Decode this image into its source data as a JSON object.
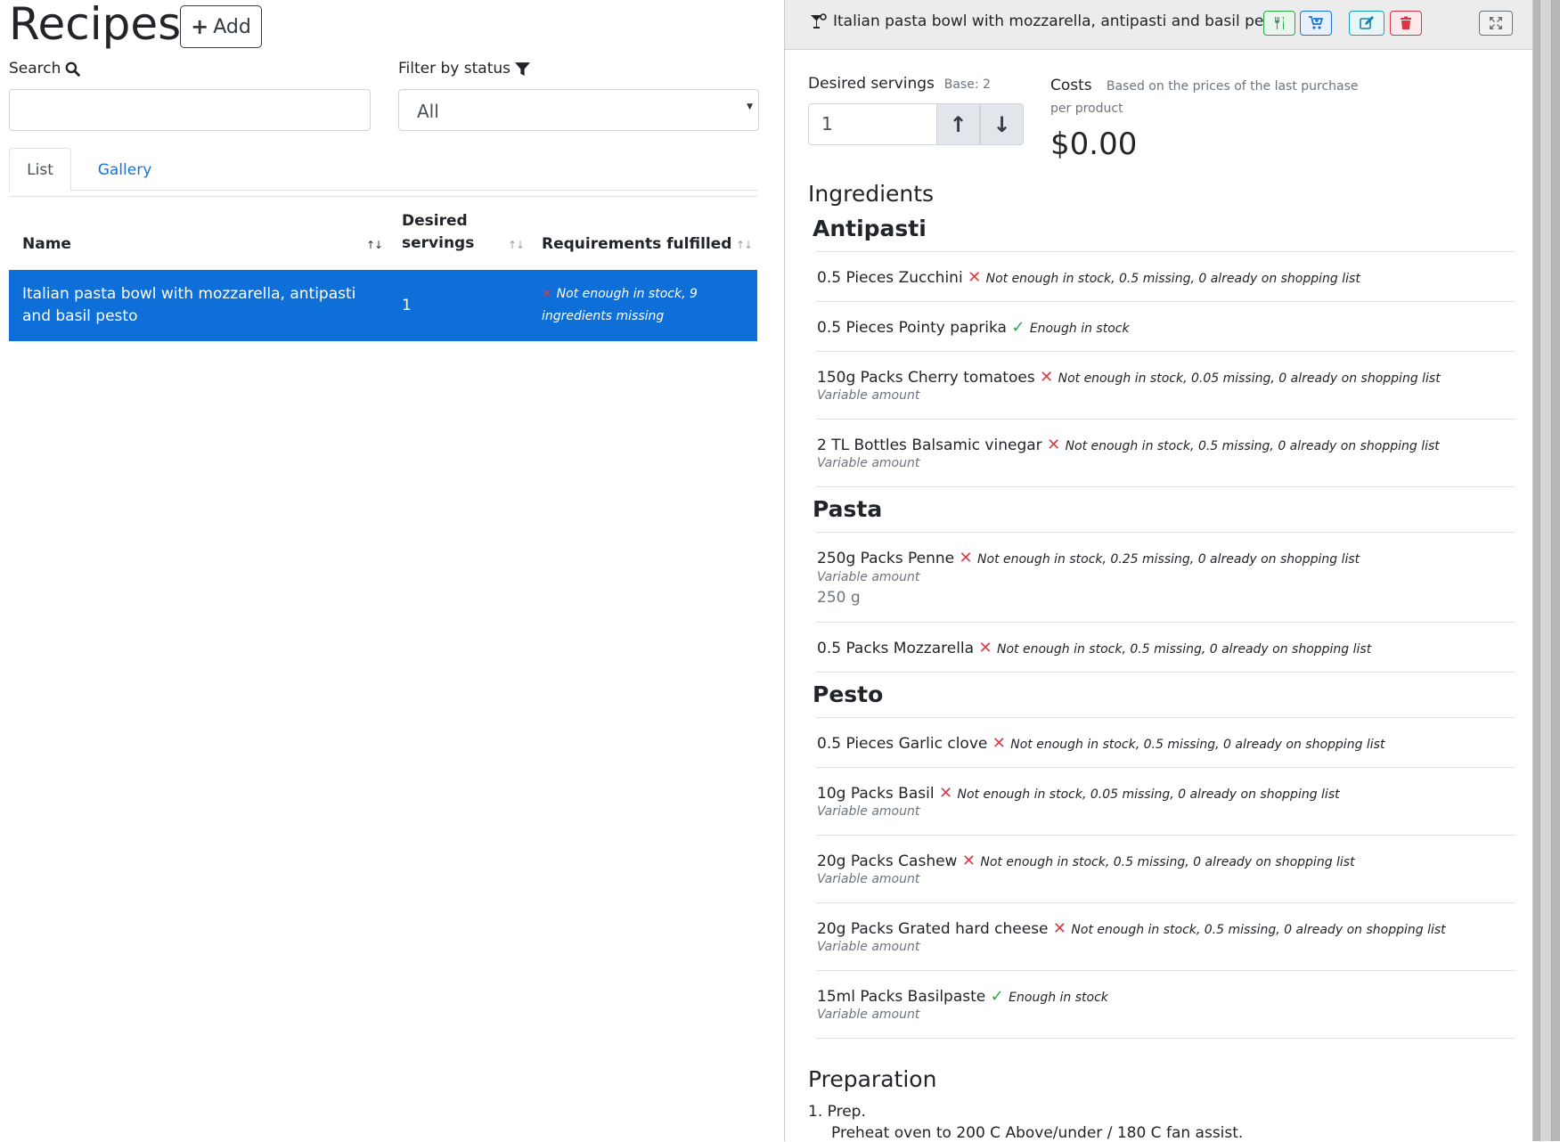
{
  "page": {
    "title": "Recipes",
    "add_label": "Add"
  },
  "search": {
    "label": "Search",
    "value": ""
  },
  "filter": {
    "label": "Filter by status",
    "selected": "All"
  },
  "tabs": [
    {
      "label": "List"
    },
    {
      "label": "Gallery"
    }
  ],
  "table": {
    "headers": [
      "Name",
      "Desired servings",
      "Requirements fulfilled"
    ],
    "rows": [
      {
        "name": "Italian pasta bowl with mozzarella, antipasti and basil pesto",
        "servings": "1",
        "requirements": "Not enough in stock, 9 ingredients missing"
      }
    ]
  },
  "recipe": {
    "title": "Italian pasta bowl with mozzarella, antipasti and basil pesto",
    "desired_servings_label": "Desired servings",
    "base_label": "Base: 2",
    "servings_value": "1",
    "costs_label": "Costs",
    "costs_note": "Based on the prices of the last purchase per product",
    "cost_value": "$0.00",
    "ingredients_heading": "Ingredients",
    "groups": [
      {
        "name": "Antipasti",
        "items": [
          {
            "text": "0.5 Pieces Zucchini",
            "ok": false,
            "note": "Not enough in stock, 0.5 missing, 0 already on shopping list"
          },
          {
            "text": "0.5 Pieces Pointy paprika",
            "ok": true,
            "note": "Enough in stock"
          },
          {
            "text": "150g Packs Cherry tomatoes",
            "ok": false,
            "note": "Not enough in stock, 0.05 missing, 0 already on shopping list",
            "variable": "Variable amount"
          },
          {
            "text": "2 TL Bottles Balsamic vinegar",
            "ok": false,
            "note": "Not enough in stock, 0.5 missing, 0 already on shopping list",
            "variable": "Variable amount"
          }
        ]
      },
      {
        "name": "Pasta",
        "items": [
          {
            "text": "250g Packs Penne",
            "ok": false,
            "note": "Not enough in stock, 0.25 missing, 0 already on shopping list",
            "variable": "Variable amount",
            "amount": "250 g"
          },
          {
            "text": "0.5 Packs Mozzarella",
            "ok": false,
            "note": "Not enough in stock, 0.5 missing, 0 already on shopping list"
          }
        ]
      },
      {
        "name": "Pesto",
        "items": [
          {
            "text": "0.5 Pieces Garlic clove",
            "ok": false,
            "note": "Not enough in stock, 0.5 missing, 0 already on shopping list"
          },
          {
            "text": "10g Packs Basil",
            "ok": false,
            "note": "Not enough in stock, 0.05 missing, 0 already on shopping list",
            "variable": "Variable amount"
          },
          {
            "text": "20g Packs Cashew",
            "ok": false,
            "note": "Not enough in stock, 0.5 missing, 0 already on shopping list",
            "variable": "Variable amount"
          },
          {
            "text": "20g Packs Grated hard cheese",
            "ok": false,
            "note": "Not enough in stock, 0.5 missing, 0 already on shopping list",
            "variable": "Variable amount"
          },
          {
            "text": "15ml Packs Basilpaste",
            "ok": true,
            "note": "Enough in stock",
            "variable": "Variable amount"
          }
        ]
      }
    ],
    "preparation_heading": "Preparation",
    "prep_step": "1. Prep.",
    "prep_text": "Preheat oven to 200 C Above/under / 180 C fan assist."
  },
  "colors": {
    "accent": "#0d6fd7",
    "danger": "#e03a47",
    "success": "#28a745"
  }
}
